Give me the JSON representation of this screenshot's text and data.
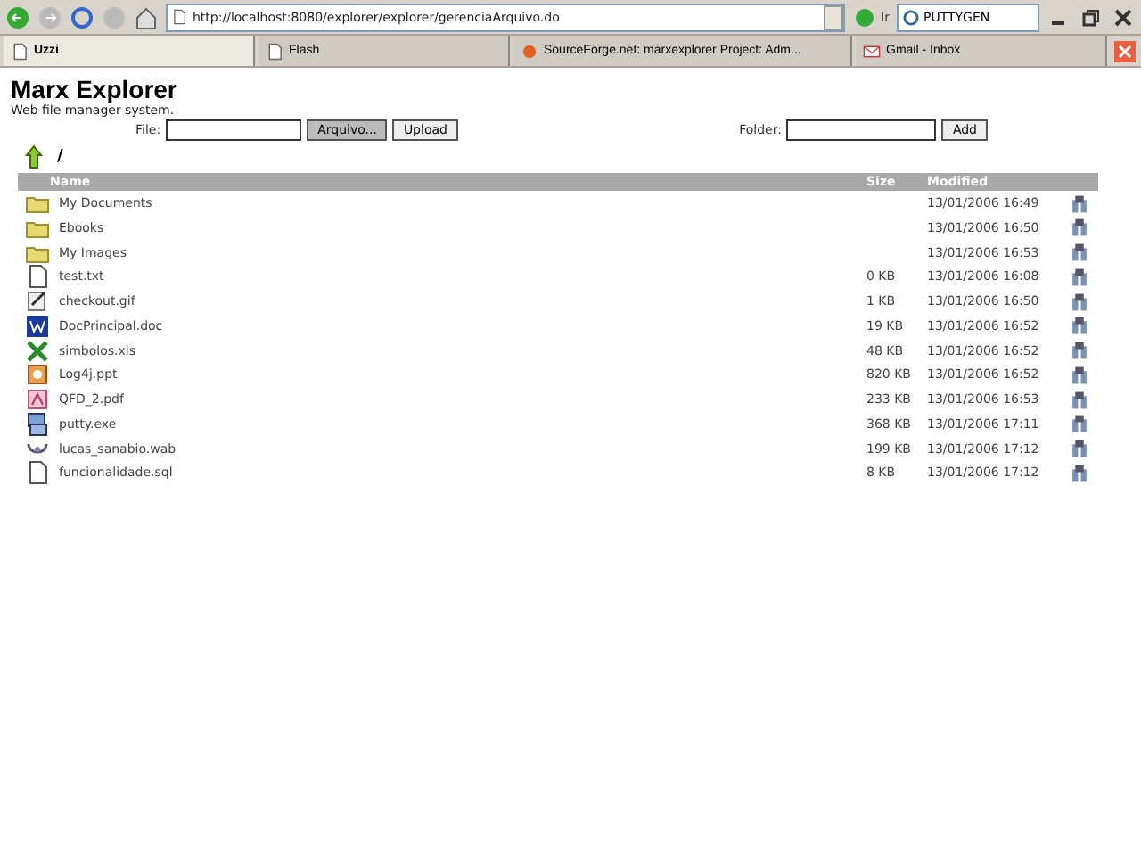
{
  "browser": {
    "address": "http://localhost:8080/explorer/explorer/gerenciaArquivo.do",
    "go_label": "Ir",
    "search_value": "PUTTYGEN"
  },
  "tabs": [
    {
      "label": "Uzzi",
      "selected": true
    },
    {
      "label": "Flash",
      "selected": false
    },
    {
      "label": "SourceForge.net: marxexplorer Project: Adm...",
      "selected": false
    },
    {
      "label": "Gmail - Inbox",
      "selected": false
    }
  ],
  "app": {
    "title": "Marx Explorer",
    "subtitle": "Web file manager system."
  },
  "upload": {
    "label": "File:",
    "browse_button": "Arquivo...",
    "submit_button": "Upload"
  },
  "folder_form": {
    "label": "Folder:",
    "submit_button": "Add"
  },
  "path": "/",
  "table": {
    "columns": [
      "Name",
      "Size",
      "Modified"
    ],
    "rows": [
      {
        "kind": "folder",
        "name": "My Documents",
        "modified": "13/01/2006 16:49"
      },
      {
        "kind": "folder",
        "name": "Ebooks",
        "modified": "13/01/2006 16:50"
      },
      {
        "kind": "folder",
        "name": "My Images",
        "modified": "13/01/2006 16:53"
      },
      {
        "kind": "text",
        "name": "test.txt",
        "size": "0 KB",
        "modified": "13/01/2006 16:08"
      },
      {
        "kind": "image",
        "name": "checkout.gif",
        "size": "1 KB",
        "modified": "13/01/2006 16:50"
      },
      {
        "kind": "word",
        "name": "DocPrincipal.doc",
        "size": "19 KB",
        "modified": "13/01/2006 16:52"
      },
      {
        "kind": "excel",
        "name": "simbolos.xls",
        "size": "48 KB",
        "modified": "13/01/2006 16:52"
      },
      {
        "kind": "slides",
        "name": "Log4j.ppt",
        "size": "820 KB",
        "modified": "13/01/2006 16:52"
      },
      {
        "kind": "pdf",
        "name": "QFD_2.pdf",
        "size": "233 KB",
        "modified": "13/01/2006 16:53"
      },
      {
        "kind": "exe",
        "name": "putty.exe",
        "size": "368 KB",
        "modified": "13/01/2006 17:11"
      },
      {
        "kind": "audio",
        "name": "lucas_sanabio.wab",
        "size": "199 KB",
        "modified": "13/01/2006 17:12"
      },
      {
        "kind": "text",
        "name": "funcionalidade.sql",
        "size": "8 KB",
        "modified": "13/01/2006 17:12"
      }
    ]
  }
}
